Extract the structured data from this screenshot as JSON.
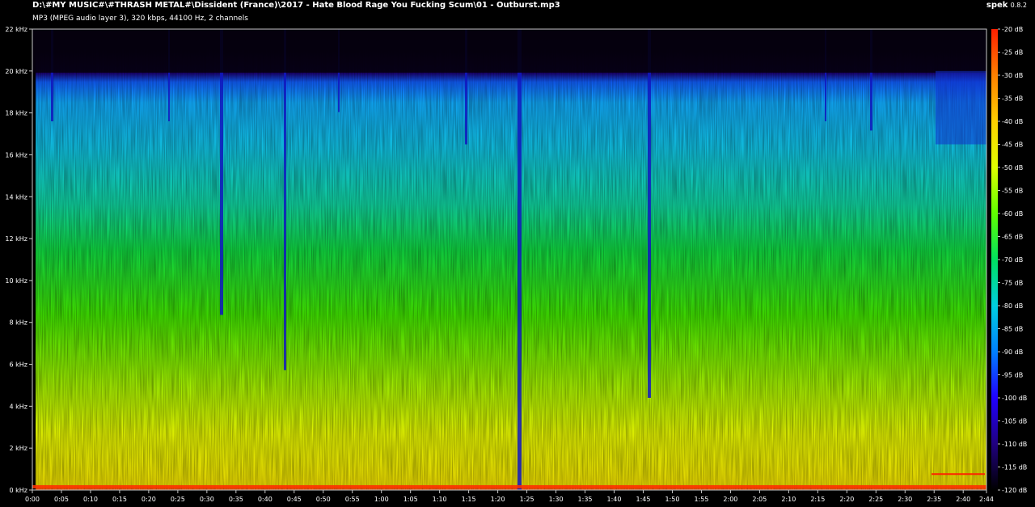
{
  "header": {
    "file_path": "D:\\#MY MUSIC#\\#THRASH METAL#\\Dissident (France)\\2017 - Hate Blood Rage You Fucking Scum\\01 - Outburst.mp3",
    "file_info": "MP3 (MPEG audio layer 3), 320 kbps, 44100 Hz, 2 channels",
    "app_name": "spek",
    "app_version": "0.8.2"
  },
  "chart_data": {
    "type": "heatmap",
    "title": "",
    "xlabel": "",
    "ylabel": "",
    "x_range_seconds": [
      0,
      164
    ],
    "y_range_khz": [
      0,
      22
    ],
    "db_range": [
      -120,
      -20
    ],
    "x_ticks": [
      "0:00",
      "0:05",
      "0:10",
      "0:15",
      "0:20",
      "0:25",
      "0:30",
      "0:35",
      "0:40",
      "0:45",
      "0:50",
      "0:55",
      "1:00",
      "1:05",
      "1:10",
      "1:15",
      "1:20",
      "1:25",
      "1:30",
      "1:35",
      "1:40",
      "1:45",
      "1:50",
      "1:55",
      "2:00",
      "2:05",
      "2:10",
      "2:15",
      "2:20",
      "2:25",
      "2:30",
      "2:35",
      "2:40",
      "2:44"
    ],
    "y_ticks": [
      "0 kHz",
      "2 kHz",
      "4 kHz",
      "6 kHz",
      "8 kHz",
      "10 kHz",
      "12 kHz",
      "14 kHz",
      "16 kHz",
      "18 kHz",
      "20 kHz",
      "22 kHz"
    ],
    "db_ticks": [
      "-20 dB",
      "-25 dB",
      "-30 dB",
      "-35 dB",
      "-40 dB",
      "-45 dB",
      "-50 dB",
      "-55 dB",
      "-60 dB",
      "-65 dB",
      "-70 dB",
      "-75 dB",
      "-80 dB",
      "-85 dB",
      "-90 dB",
      "-95 dB",
      "-100 dB",
      "-105 dB",
      "-110 dB",
      "-115 dB",
      "-120 dB"
    ],
    "grid": false,
    "colormap": [
      "#000000",
      "#1a0050",
      "#2020ff",
      "#00c8ff",
      "#10d860",
      "#30ff00",
      "#e0ff00",
      "#ffc000",
      "#ff2000"
    ]
  }
}
